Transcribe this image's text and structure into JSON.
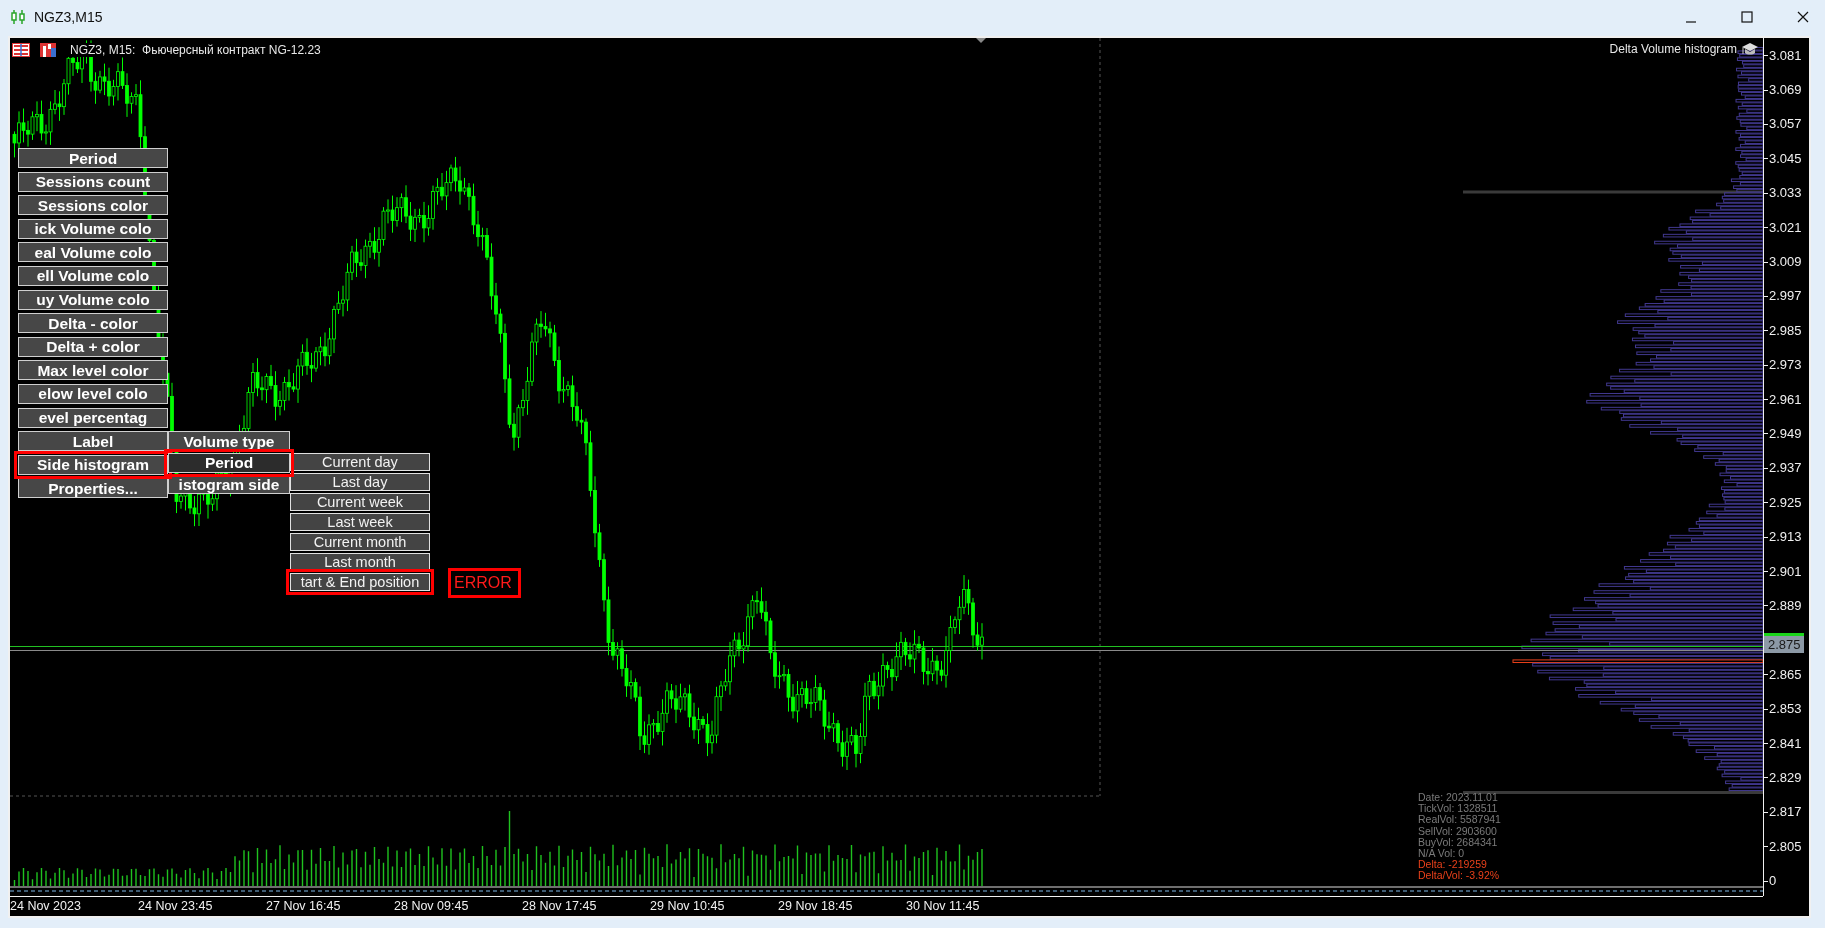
{
  "window": {
    "title": "NGZ3,M15"
  },
  "chart": {
    "header": "NGZ3, M15:  Фьючерсный контракт NG-12.23",
    "indicator_label": "Delta Volume histogram",
    "price_axis": [
      {
        "label": "3.081",
        "kind": "tick"
      },
      {
        "label": "3.069",
        "kind": "tick"
      },
      {
        "label": "3.057",
        "kind": "tick"
      },
      {
        "label": "3.045",
        "kind": "tick"
      },
      {
        "label": "3.033",
        "kind": "tick"
      },
      {
        "label": "3.021",
        "kind": "tick"
      },
      {
        "label": "3.009",
        "kind": "tick"
      },
      {
        "label": "2.997",
        "kind": "tick"
      },
      {
        "label": "2.985",
        "kind": "tick"
      },
      {
        "label": "2.973",
        "kind": "tick"
      },
      {
        "label": "2.961",
        "kind": "tick"
      },
      {
        "label": "2.949",
        "kind": "tick"
      },
      {
        "label": "2.937",
        "kind": "tick"
      },
      {
        "label": "2.925",
        "kind": "tick"
      },
      {
        "label": "2.913",
        "kind": "tick"
      },
      {
        "label": "2.901",
        "kind": "tick"
      },
      {
        "label": "2.889",
        "kind": "tick"
      },
      {
        "label": "2.875",
        "kind": "current"
      },
      {
        "label": "2.865",
        "kind": "tick"
      },
      {
        "label": "2.853",
        "kind": "tick"
      },
      {
        "label": "2.841",
        "kind": "tick"
      },
      {
        "label": "2.829",
        "kind": "tick"
      },
      {
        "label": "2.817",
        "kind": "tick"
      },
      {
        "label": "2.805",
        "kind": "tick"
      },
      {
        "label": "0",
        "kind": "tick"
      }
    ],
    "time_axis": [
      "24 Nov 2023",
      "24 Nov 23:45",
      "27 Nov 16:45",
      "28 Nov 09:45",
      "28 Nov 17:45",
      "29 Nov 10:45",
      "29 Nov 18:45",
      "30 Nov 11:45"
    ],
    "info": [
      {
        "text": "Date: 2023.11.01",
        "kind": "stat"
      },
      {
        "text": "TickVol: 1328511",
        "kind": "stat"
      },
      {
        "text": "RealVol: 5587941",
        "kind": "stat"
      },
      {
        "text": "SellVol: 2903600",
        "kind": "stat"
      },
      {
        "text": "BuyVol: 2684341",
        "kind": "stat"
      },
      {
        "text": "N/A Vol: 0",
        "kind": "stat"
      },
      {
        "text": "Delta: -219259",
        "kind": "delta"
      },
      {
        "text": "Delta/Vol: -3.92%",
        "kind": "delta"
      }
    ]
  },
  "menu": {
    "items": [
      {
        "label": "Period",
        "highlighted": false
      },
      {
        "label": "Sessions count",
        "highlighted": false
      },
      {
        "label": "Sessions color",
        "highlighted": false
      },
      {
        "label": "ick Volume colo",
        "highlighted": false
      },
      {
        "label": "eal Volume colo",
        "highlighted": false
      },
      {
        "label": "ell Volume colo",
        "highlighted": false
      },
      {
        "label": "uy Volume colo",
        "highlighted": false
      },
      {
        "label": "Delta - color",
        "highlighted": false
      },
      {
        "label": "Delta + color",
        "highlighted": false
      },
      {
        "label": "Max level color",
        "highlighted": false
      },
      {
        "label": "elow level colo",
        "highlighted": false
      },
      {
        "label": "evel percentag",
        "highlighted": false
      },
      {
        "label": "Label",
        "highlighted": false
      },
      {
        "label": "Side histogram",
        "highlighted": true
      },
      {
        "label": "Properties...",
        "highlighted": false
      }
    ],
    "submenu": [
      {
        "label": "Volume type",
        "selected": false,
        "highlighted": false
      },
      {
        "label": "Period",
        "selected": true,
        "highlighted": true
      },
      {
        "label": "istogram side",
        "selected": false,
        "highlighted": false
      }
    ],
    "period_options": [
      {
        "label": "Current day",
        "highlighted": false
      },
      {
        "label": "Last day",
        "highlighted": false
      },
      {
        "label": "Current week",
        "highlighted": false
      },
      {
        "label": "Last week",
        "highlighted": false
      },
      {
        "label": "Current month",
        "highlighted": false
      },
      {
        "label": "Last month",
        "highlighted": false
      },
      {
        "label": "tart & End position",
        "highlighted": true
      }
    ],
    "annotation": "ERROR"
  }
}
